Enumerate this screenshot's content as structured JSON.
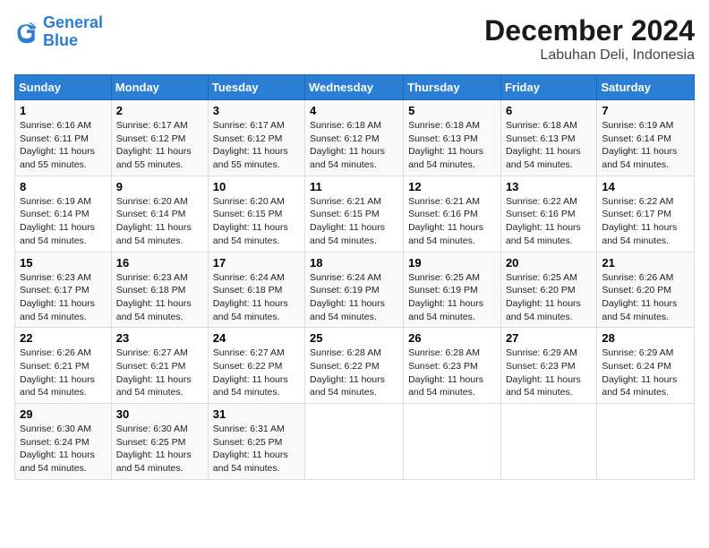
{
  "logo": {
    "line1": "General",
    "line2": "Blue"
  },
  "title": "December 2024",
  "subtitle": "Labuhan Deli, Indonesia",
  "days_of_week": [
    "Sunday",
    "Monday",
    "Tuesday",
    "Wednesday",
    "Thursday",
    "Friday",
    "Saturday"
  ],
  "weeks": [
    [
      {
        "day": 1,
        "sunrise": "6:16 AM",
        "sunset": "6:11 PM",
        "daylight": "11 hours and 55 minutes."
      },
      {
        "day": 2,
        "sunrise": "6:17 AM",
        "sunset": "6:12 PM",
        "daylight": "11 hours and 55 minutes."
      },
      {
        "day": 3,
        "sunrise": "6:17 AM",
        "sunset": "6:12 PM",
        "daylight": "11 hours and 55 minutes."
      },
      {
        "day": 4,
        "sunrise": "6:18 AM",
        "sunset": "6:12 PM",
        "daylight": "11 hours and 54 minutes."
      },
      {
        "day": 5,
        "sunrise": "6:18 AM",
        "sunset": "6:13 PM",
        "daylight": "11 hours and 54 minutes."
      },
      {
        "day": 6,
        "sunrise": "6:18 AM",
        "sunset": "6:13 PM",
        "daylight": "11 hours and 54 minutes."
      },
      {
        "day": 7,
        "sunrise": "6:19 AM",
        "sunset": "6:14 PM",
        "daylight": "11 hours and 54 minutes."
      }
    ],
    [
      {
        "day": 8,
        "sunrise": "6:19 AM",
        "sunset": "6:14 PM",
        "daylight": "11 hours and 54 minutes."
      },
      {
        "day": 9,
        "sunrise": "6:20 AM",
        "sunset": "6:14 PM",
        "daylight": "11 hours and 54 minutes."
      },
      {
        "day": 10,
        "sunrise": "6:20 AM",
        "sunset": "6:15 PM",
        "daylight": "11 hours and 54 minutes."
      },
      {
        "day": 11,
        "sunrise": "6:21 AM",
        "sunset": "6:15 PM",
        "daylight": "11 hours and 54 minutes."
      },
      {
        "day": 12,
        "sunrise": "6:21 AM",
        "sunset": "6:16 PM",
        "daylight": "11 hours and 54 minutes."
      },
      {
        "day": 13,
        "sunrise": "6:22 AM",
        "sunset": "6:16 PM",
        "daylight": "11 hours and 54 minutes."
      },
      {
        "day": 14,
        "sunrise": "6:22 AM",
        "sunset": "6:17 PM",
        "daylight": "11 hours and 54 minutes."
      }
    ],
    [
      {
        "day": 15,
        "sunrise": "6:23 AM",
        "sunset": "6:17 PM",
        "daylight": "11 hours and 54 minutes."
      },
      {
        "day": 16,
        "sunrise": "6:23 AM",
        "sunset": "6:18 PM",
        "daylight": "11 hours and 54 minutes."
      },
      {
        "day": 17,
        "sunrise": "6:24 AM",
        "sunset": "6:18 PM",
        "daylight": "11 hours and 54 minutes."
      },
      {
        "day": 18,
        "sunrise": "6:24 AM",
        "sunset": "6:19 PM",
        "daylight": "11 hours and 54 minutes."
      },
      {
        "day": 19,
        "sunrise": "6:25 AM",
        "sunset": "6:19 PM",
        "daylight": "11 hours and 54 minutes."
      },
      {
        "day": 20,
        "sunrise": "6:25 AM",
        "sunset": "6:20 PM",
        "daylight": "11 hours and 54 minutes."
      },
      {
        "day": 21,
        "sunrise": "6:26 AM",
        "sunset": "6:20 PM",
        "daylight": "11 hours and 54 minutes."
      }
    ],
    [
      {
        "day": 22,
        "sunrise": "6:26 AM",
        "sunset": "6:21 PM",
        "daylight": "11 hours and 54 minutes."
      },
      {
        "day": 23,
        "sunrise": "6:27 AM",
        "sunset": "6:21 PM",
        "daylight": "11 hours and 54 minutes."
      },
      {
        "day": 24,
        "sunrise": "6:27 AM",
        "sunset": "6:22 PM",
        "daylight": "11 hours and 54 minutes."
      },
      {
        "day": 25,
        "sunrise": "6:28 AM",
        "sunset": "6:22 PM",
        "daylight": "11 hours and 54 minutes."
      },
      {
        "day": 26,
        "sunrise": "6:28 AM",
        "sunset": "6:23 PM",
        "daylight": "11 hours and 54 minutes."
      },
      {
        "day": 27,
        "sunrise": "6:29 AM",
        "sunset": "6:23 PM",
        "daylight": "11 hours and 54 minutes."
      },
      {
        "day": 28,
        "sunrise": "6:29 AM",
        "sunset": "6:24 PM",
        "daylight": "11 hours and 54 minutes."
      }
    ],
    [
      {
        "day": 29,
        "sunrise": "6:30 AM",
        "sunset": "6:24 PM",
        "daylight": "11 hours and 54 minutes."
      },
      {
        "day": 30,
        "sunrise": "6:30 AM",
        "sunset": "6:25 PM",
        "daylight": "11 hours and 54 minutes."
      },
      {
        "day": 31,
        "sunrise": "6:31 AM",
        "sunset": "6:25 PM",
        "daylight": "11 hours and 54 minutes."
      },
      null,
      null,
      null,
      null
    ]
  ]
}
